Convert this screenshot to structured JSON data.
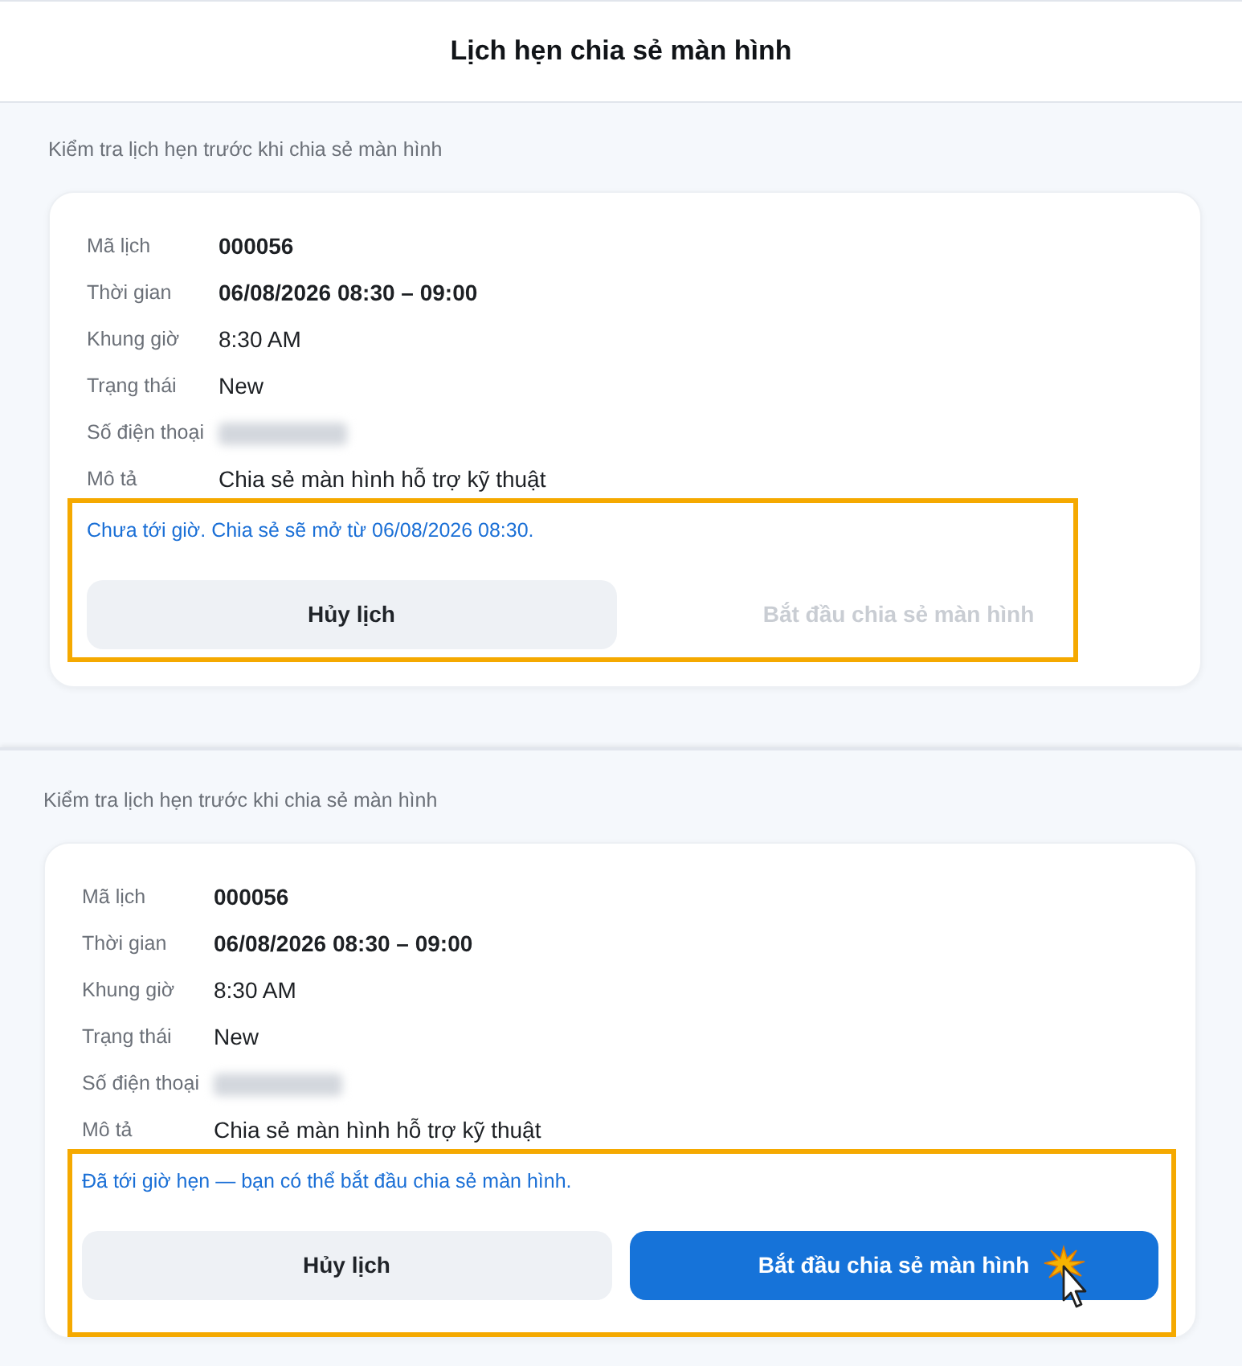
{
  "screens": [
    {
      "title": "Lịch hẹn chia sẻ màn hình",
      "subtitle": "Kiểm tra lịch hẹn trước khi chia sẻ màn hình",
      "details": [
        {
          "label": "Mã lịch",
          "value": "000056",
          "kind": "strong"
        },
        {
          "label": "Thời gian",
          "value": "06/08/2026 08:30 – 09:00",
          "kind": "strong"
        },
        {
          "label": "Khung giờ",
          "value": "8:30 AM",
          "kind": "plain"
        },
        {
          "label": "Trạng thái",
          "value": "New",
          "kind": "plain"
        },
        {
          "label": "Số điện thoại",
          "kind": "redacted"
        },
        {
          "label": "Mô tả",
          "value": "Chia sẻ màn hình hỗ trợ kỹ thuật",
          "kind": "plain"
        }
      ],
      "notice": "Chưa tới giờ. Chia sẻ sẽ mở từ 06/08/2026 08:30.",
      "highlighted": true,
      "buttons": [
        {
          "label": "Hủy lịch",
          "kind": "secondary",
          "disabled": false,
          "hovered": false
        },
        {
          "label": "Bắt đầu chia sẻ màn hình",
          "kind": "primary",
          "disabled": true,
          "hovered": false
        }
      ]
    },
    {
      "subtitle": "Kiểm tra lịch hẹn trước khi chia sẻ màn hình",
      "details": [
        {
          "label": "Mã lịch",
          "value": "000056",
          "kind": "strong"
        },
        {
          "label": "Thời gian",
          "value": "06/08/2026 08:30 – 09:00",
          "kind": "strong"
        },
        {
          "label": "Khung giờ",
          "value": "8:30 AM",
          "kind": "plain"
        },
        {
          "label": "Trạng thái",
          "value": "New",
          "kind": "plain"
        },
        {
          "label": "Số điện thoại",
          "kind": "redacted"
        },
        {
          "label": "Mô tả",
          "value": "Chia sẻ màn hình hỗ trợ kỹ thuật",
          "kind": "plain"
        }
      ],
      "notice": "Đã tới giờ hẹn — bạn có thể bắt đầu chia sẻ màn hình.",
      "highlighted": true,
      "buttons": [
        {
          "label": "Hủy lịch",
          "kind": "secondary",
          "disabled": false,
          "hovered": false
        },
        {
          "label": "Bắt đầu chia sẻ màn hình",
          "kind": "primary",
          "disabled": false,
          "hovered": true
        }
      ]
    }
  ]
}
